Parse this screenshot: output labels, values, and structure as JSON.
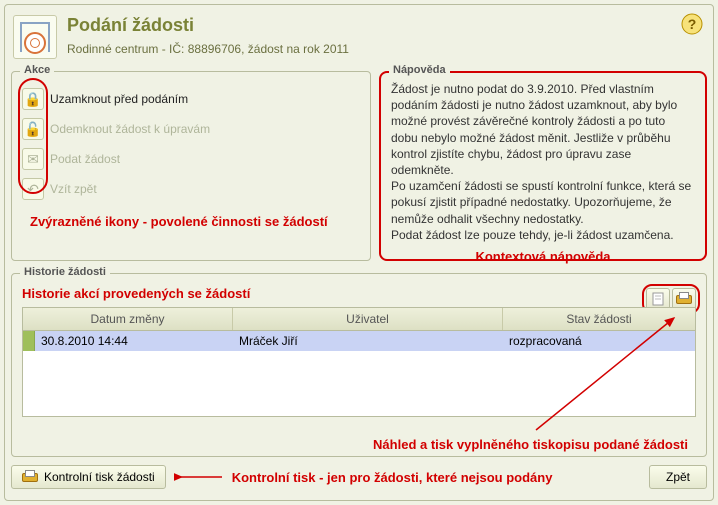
{
  "header": {
    "title": "Podání žádosti",
    "subtitle": "Rodinné centrum - IČ: 88896706, žádost na rok 2011"
  },
  "akce": {
    "legend": "Akce",
    "items": [
      {
        "icon": "lock-icon",
        "glyph": "🔒",
        "label": "Uzamknout před podáním",
        "enabled": true
      },
      {
        "icon": "unlock-icon",
        "glyph": "🔓",
        "label": "Odemknout žádost k úpravám",
        "enabled": false
      },
      {
        "icon": "submit-icon",
        "glyph": "✉",
        "label": "Podat žádost",
        "enabled": false
      },
      {
        "icon": "undo-icon",
        "glyph": "↶",
        "label": "Vzít zpět",
        "enabled": false
      }
    ],
    "note": "Zvýrazněné ikony - povolené činnosti se žádostí"
  },
  "napoveda": {
    "legend": "Nápověda",
    "body": "Žádost je nutno podat do 3.9.2010. Před vlastním podáním žádosti je nutno žádost uzamknout, aby bylo možné provést závěrečné kontroly žádosti a po tuto dobu nebylo možné žádost měnit. Jestliže v průběhu kontrol zjistíte chybu, žádost pro úpravu zase odemkněte.\nPo uzamčení žádosti se spustí kontrolní funkce, která se pokusí zjistit případné nedostatky. Upozorňujeme, že nemůže odhalit všechny nedostatky.\nPodat žádost lze pouze tehdy, je-li žádost uzamčena.",
    "caption": "Kontextová nápověda"
  },
  "historie": {
    "legend": "Historie žádosti",
    "title": "Historie akcí provedených se žádostí",
    "columns": [
      "Datum změny",
      "Uživatel",
      "Stav žádosti"
    ],
    "rows": [
      {
        "datum": "30.8.2010 14:44",
        "uzivatel": "Mráček Jiří",
        "stav": "rozpracovaná"
      }
    ],
    "annot": "Náhled a tisk vyplněného tiskopisu podané žádosti"
  },
  "footer": {
    "print_label": "Kontrolní tisk žádosti",
    "note": "Kontrolní tisk - jen pro žádosti, které nejsou podány",
    "back_label": "Zpět"
  }
}
